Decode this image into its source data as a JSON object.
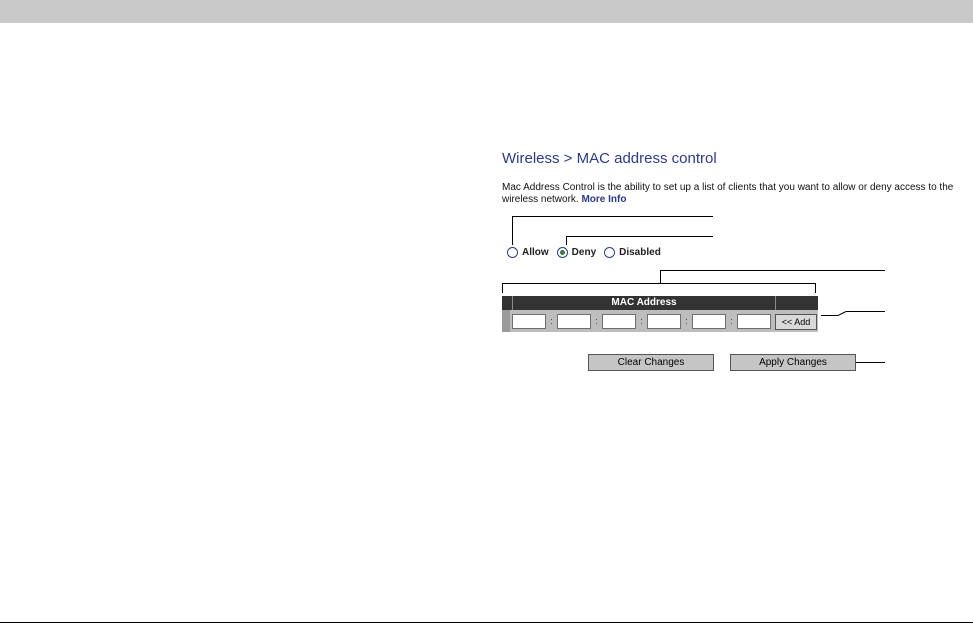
{
  "page": {
    "title": "Wireless > MAC address control",
    "description": "Mac Address Control is the ability to set up a list of clients that you want to allow or deny access to the wireless network. ",
    "more_info_label": "More Info"
  },
  "access_mode": {
    "options": [
      {
        "label": "Allow",
        "checked": false
      },
      {
        "label": "Deny",
        "checked": true
      },
      {
        "label": "Disabled",
        "checked": false
      }
    ]
  },
  "mac_table": {
    "header": "MAC Address",
    "octet_values": [
      "",
      "",
      "",
      "",
      "",
      ""
    ],
    "separator": ":",
    "add_label": "<< Add"
  },
  "actions": {
    "clear_label": "Clear Changes",
    "apply_label": "Apply Changes"
  },
  "colors": {
    "title": "#2b3a8f",
    "header_bar": "#333333",
    "top_band": "#c9c9c9",
    "button_face": "#c5c5c5"
  }
}
